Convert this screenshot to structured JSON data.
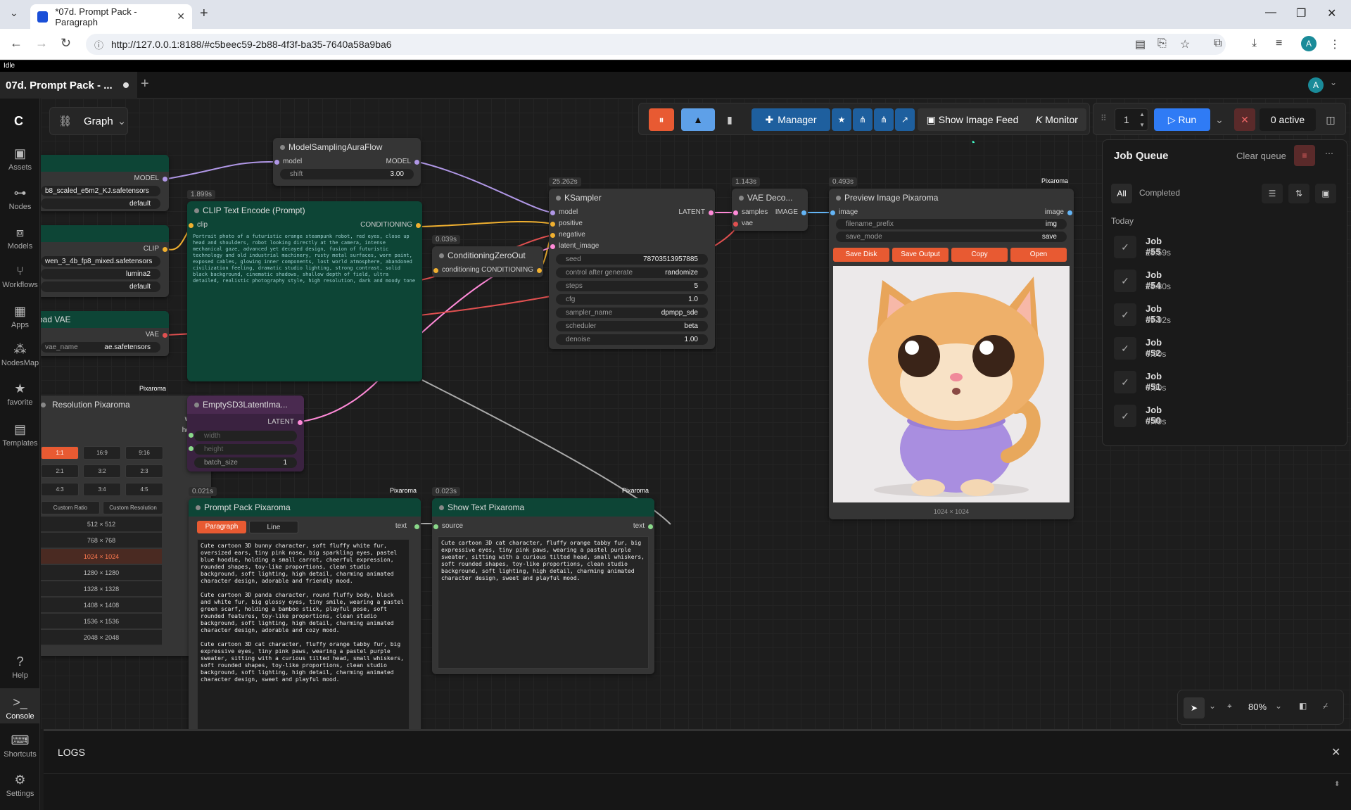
{
  "browser": {
    "tab_title": "*07d. Prompt Pack - Paragraph",
    "url": "http://127.0.0.1:8188/#c5beec59-2b88-4f3f-ba35-7640a58a9ba6",
    "profile": "A"
  },
  "status": "Idle",
  "app_tab": {
    "title": "07d. Prompt Pack - ..."
  },
  "user": "A",
  "sidebar": {
    "items": [
      {
        "label": "Assets",
        "icon": "image-icon"
      },
      {
        "label": "Nodes",
        "icon": "nodes-icon"
      },
      {
        "label": "Models",
        "icon": "models-icon"
      },
      {
        "label": "Workflows",
        "icon": "workflows-icon"
      },
      {
        "label": "Apps",
        "icon": "apps-icon"
      },
      {
        "label": "NodesMap",
        "icon": "nodesmap-icon"
      },
      {
        "label": "favorite",
        "icon": "star-icon"
      },
      {
        "label": "Templates",
        "icon": "templates-icon"
      },
      {
        "label": "Help",
        "icon": "help-icon"
      },
      {
        "label": "Console",
        "icon": "console-icon"
      },
      {
        "label": "Shortcuts",
        "icon": "keyboard-icon"
      },
      {
        "label": "Settings",
        "icon": "gear-icon"
      }
    ]
  },
  "graph_label": "Graph",
  "toolbar": {
    "manager": "Manager",
    "image_feed": "Show Image Feed",
    "monitor": "Monitor",
    "batch": "1",
    "run": "Run",
    "active": "0 active"
  },
  "job_queue": {
    "title": "Job Queue",
    "clear": "Clear queue",
    "filter_all": "All",
    "filter_completed": "Completed",
    "today": "Today",
    "jobs": [
      {
        "name": "Job #55",
        "dur": "28.59s"
      },
      {
        "name": "Job #54",
        "dur": "28.80s"
      },
      {
        "name": "Job #53",
        "dur": "39.92s"
      },
      {
        "name": "Job #52",
        "dur": "0.00s"
      },
      {
        "name": "Job #51",
        "dur": "0.00s"
      },
      {
        "name": "Job #50",
        "dur": "0.49s"
      }
    ]
  },
  "nodes": {
    "loader": {
      "model_out": "MODEL",
      "unet": "b8_scaled_e5m2_KJ.safetensors",
      "dtype": "default"
    },
    "clip_loader": {
      "clip_out": "CLIP",
      "name": "wen_3_4b_fp8_mixed.safetensors",
      "type": "lumina2",
      "device": "default"
    },
    "vae_loader": {
      "title": "oad VAE",
      "out": "VAE",
      "w_label": "vae_name",
      "w_val": "ae.safetensors"
    },
    "msaf": {
      "title": "ModelSamplingAuraFlow",
      "in": "model",
      "out": "MODEL",
      "w_label": "shift",
      "w_val": "3.00"
    },
    "clip_encode": {
      "timer": "1.899s",
      "title": "CLIP Text Encode (Prompt)",
      "in": "clip",
      "out": "CONDITIONING",
      "text": "Portrait photo of a futuristic orange steampunk robot, red eyes, close up head and shoulders, robot looking directly at the camera, intense mechanical gaze, advanced yet decayed design, fusion of futuristic technology and old industrial machinery, rusty metal surfaces, worn paint, exposed cables, glowing inner components, lost world atmosphere, abandoned civilization feeling, dramatic studio lighting, strong contrast, solid black background, cinematic shadows, shallow depth of field, ultra detailed, realistic photography style, high resolution, dark and moody tone"
    },
    "czo": {
      "timer": "0.039s",
      "title": "ConditioningZeroOut",
      "in": "conditioning",
      "out": "CONDITIONING"
    },
    "ksampler": {
      "timer": "25.262s",
      "title": "KSampler",
      "inputs": [
        "model",
        "positive",
        "negative",
        "latent_image"
      ],
      "out": "LATENT",
      "widgets": [
        {
          "l": "seed",
          "v": "78703513957885"
        },
        {
          "l": "control after generate",
          "v": "randomize"
        },
        {
          "l": "steps",
          "v": "5"
        },
        {
          "l": "cfg",
          "v": "1.0"
        },
        {
          "l": "sampler_name",
          "v": "dpmpp_sde"
        },
        {
          "l": "scheduler",
          "v": "beta"
        },
        {
          "l": "denoise",
          "v": "1.00"
        }
      ]
    },
    "vae_decode": {
      "timer": "1.143s",
      "title": "VAE Deco...",
      "in1": "samples",
      "in2": "vae",
      "out": "IMAGE"
    },
    "preview": {
      "timer": "0.493s",
      "badge": "Pixaroma",
      "title": "Preview Image Pixaroma",
      "in": "image",
      "out": "image",
      "w1_label": "filename_prefix",
      "w1_val": "img",
      "w2_label": "save_mode",
      "w2_val": "save",
      "btns": [
        "Save Disk",
        "Save Output",
        "Copy",
        "Open"
      ],
      "caption": "1024 × 1024"
    },
    "resolution": {
      "badge": "Pixaroma",
      "title": "Resolution Pixaroma",
      "out1": "width",
      "out2": "height",
      "ratios": [
        "1:1",
        "16:9",
        "9:16",
        "2:1",
        "3:2",
        "2:3",
        "4:3",
        "3:4",
        "4:5"
      ],
      "custom": [
        "Custom Ratio",
        "Custom Resolution"
      ],
      "sizes": [
        "512 × 512",
        "768 × 768",
        "1024 × 1024",
        "1280 × 1280",
        "1328 × 1328",
        "1408 × 1408",
        "1536 × 1536",
        "2048 × 2048"
      ],
      "selected": "1024 × 1024"
    },
    "latent": {
      "title": "EmptySD3LatentIma...",
      "out": "LATENT",
      "w1": "width",
      "w2": "height",
      "w3_label": "batch_size",
      "w3_val": "1"
    },
    "prompt_pack": {
      "timer": "0.021s",
      "badge": "Pixaroma",
      "title": "Prompt Pack Pixaroma",
      "tab1": "Paragraph",
      "tab2": "Line",
      "out": "text",
      "p1": "Cute cartoon 3D bunny character, soft fluffy white fur, oversized ears, tiny pink nose, big sparkling eyes, pastel blue hoodie, holding a small carrot, cheerful expression, rounded shapes, toy-like proportions, clean studio background, soft lighting, high detail, charming animated character design, adorable and friendly mood.",
      "p2": "Cute cartoon 3D panda character, round fluffy body, black and white fur, big glossy eyes, tiny smile, wearing a pastel green scarf, holding a bamboo stick, playful pose, soft rounded features, toy-like proportions, clean studio background, soft lighting, high detail, charming animated character design, adorable and cozy mood.",
      "p3": "Cute cartoon 3D cat character, fluffy orange tabby fur, big expressive eyes, tiny pink paws, wearing a pastel purple sweater, sitting with a curious tilted head, small whiskers, soft rounded shapes, toy-like proportions, clean studio background, soft lighting, high detail, charming animated character design, sweet and playful mood."
    },
    "show_text": {
      "timer": "0.023s",
      "badge": "Pixaroma",
      "title": "Show Text Pixaroma",
      "in": "source",
      "out": "text",
      "text": "Cute cartoon 3D cat character, fluffy orange tabby fur, big expressive eyes, tiny pink paws, wearing a pastel purple sweater, sitting with a curious tilted head, small whiskers, soft rounded shapes, toy-like proportions, clean studio background, soft lighting, high detail, charming animated character design, sweet and playful mood."
    }
  },
  "zoom": "80%",
  "logs_title": "LOGS",
  "colors": {
    "accent": "#e85a32",
    "run": "#2f7bf5",
    "manager": "#1e5f9e",
    "green_node": "#0d4536"
  }
}
